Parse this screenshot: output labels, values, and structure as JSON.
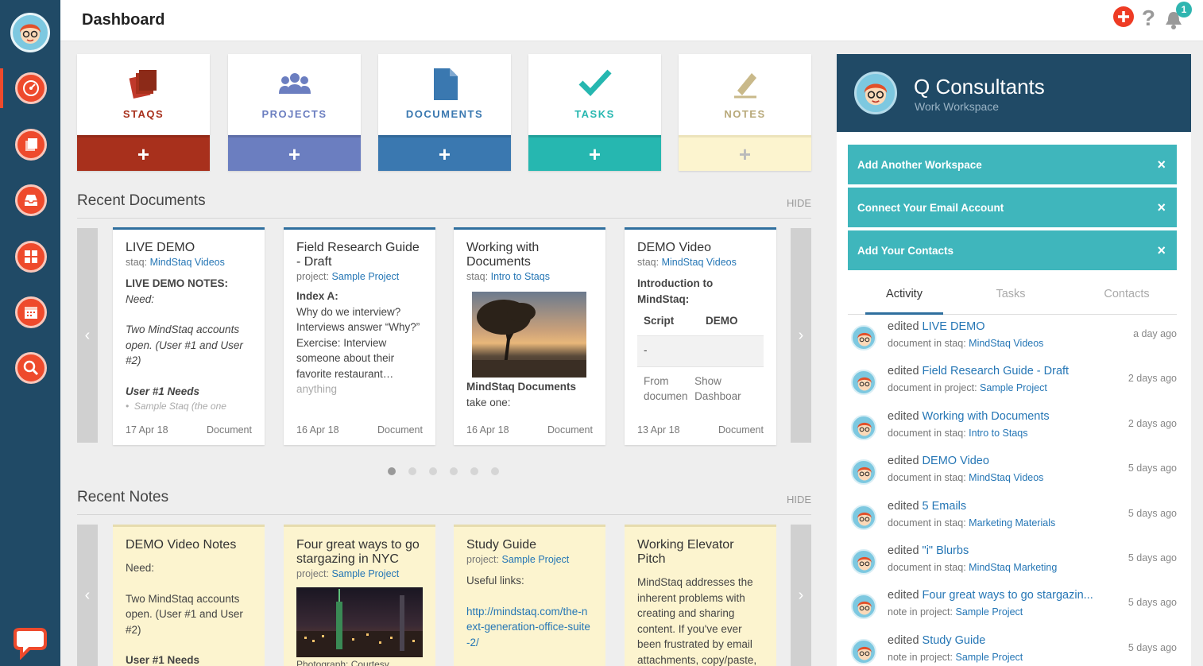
{
  "header": {
    "title": "Dashboard",
    "notification_count": "1"
  },
  "tiles": [
    {
      "label": "STAQS",
      "add": "+",
      "color": "#a8301c"
    },
    {
      "label": "PROJECTS",
      "add": "+",
      "color": "#6b7ec0"
    },
    {
      "label": "DOCUMENTS",
      "add": "+",
      "color": "#3a78b0"
    },
    {
      "label": "TASKS",
      "add": "+",
      "color": "#26b7b0"
    },
    {
      "label": "NOTES",
      "add": "+",
      "color": "#fcf4cf"
    }
  ],
  "recent_documents": {
    "title": "Recent Documents",
    "hide": "HIDE",
    "cards": [
      {
        "title": "LIVE DEMO",
        "sub_prefix": "staq:",
        "sub_link": "MindStaq Videos",
        "body1": "LIVE DEMO NOTES:",
        "body2": "Need:",
        "body3": "Two MindStaq accounts open. (User #1 and User #2)",
        "body4": "User #1 Needs",
        "body5": "Sample Staq (the one",
        "date": "17 Apr 18",
        "kind": "Document"
      },
      {
        "title": "Field Research Guide - Draft",
        "sub_prefix": "project:",
        "sub_link": "Sample Project",
        "body1": "Index A:",
        "body2": "Why do we interview? Interviews answer “Why?”",
        "body3": "Exercise: Interview someone about their favorite restaurant…",
        "body4": "anything",
        "date": "16 Apr 18",
        "kind": "Document"
      },
      {
        "title": "Working with Documents",
        "sub_prefix": "staq:",
        "sub_link": "Intro to Staqs",
        "body1": "MindStaq Documents",
        "body2": "take one:",
        "date": "16 Apr 18",
        "kind": "Document"
      },
      {
        "title": "DEMO Video",
        "sub_prefix": "staq:",
        "sub_link": "MindStaq Videos",
        "body1": "Introduction to MindStaq:",
        "col1": "Script",
        "col2": "DEMO",
        "cell": "-",
        "r1": "From documen",
        "r2": "Show Dashboar",
        "date": "13 Apr 18",
        "kind": "Document"
      }
    ]
  },
  "recent_notes": {
    "title": "Recent Notes",
    "hide": "HIDE",
    "cards": [
      {
        "title": "DEMO Video Notes",
        "body1": "Need:",
        "body2": "Two MindStaq accounts open. (User #1 and User #2)",
        "body3": "User #1 Needs"
      },
      {
        "title": "Four great ways to go stargazing in NYC",
        "sub_prefix": "project:",
        "sub_link": "Sample Project",
        "caption": "Photograph: Courtesy"
      },
      {
        "title": "Study Guide",
        "sub_prefix": "project:",
        "sub_link": "Sample Project",
        "body1": "Useful links:",
        "body2": "http://mindstaq.com/the-next-generation-office-suite-2/"
      },
      {
        "title": "Working Elevator Pitch",
        "body1": "MindStaq addresses the inherent problems with creating and sharing content. If you've ever been frustrated by email attachments, copy/paste,"
      }
    ]
  },
  "panel": {
    "workspace_name": "Q Consultants",
    "workspace_sub": "Work Workspace",
    "setup": [
      "Add Another Workspace",
      "Connect Your Email Account",
      "Add Your Contacts"
    ],
    "close": "×",
    "tabs": [
      "Activity",
      "Tasks",
      "Contacts"
    ],
    "activity": [
      {
        "verb": "edited",
        "item": "LIVE DEMO",
        "ctx": "document in staq:",
        "ctx_link": "MindStaq Videos",
        "time": "a day ago"
      },
      {
        "verb": "edited",
        "item": "Field Research Guide - Draft",
        "ctx": "document in project:",
        "ctx_link": "Sample Project",
        "time": "2 days ago"
      },
      {
        "verb": "edited",
        "item": "Working with Documents",
        "ctx": "document in staq:",
        "ctx_link": "Intro to Staqs",
        "time": "2 days ago"
      },
      {
        "verb": "edited",
        "item": "DEMO Video",
        "ctx": "document in staq:",
        "ctx_link": "MindStaq Videos",
        "time": "5 days ago"
      },
      {
        "verb": "edited",
        "item": "5 Emails",
        "ctx": "document in staq:",
        "ctx_link": "Marketing Materials",
        "time": "5 days ago"
      },
      {
        "verb": "edited",
        "item": "\"i\" Blurbs",
        "ctx": "document in staq:",
        "ctx_link": "MindStaq Marketing",
        "time": "5 days ago"
      },
      {
        "verb": "edited",
        "item": "Four great ways to go stargazin...",
        "ctx": "note in project:",
        "ctx_link": "Sample Project",
        "time": "5 days ago"
      },
      {
        "verb": "edited",
        "item": "Study Guide",
        "ctx": "note in project:",
        "ctx_link": "Sample Project",
        "time": "5 days ago"
      }
    ]
  },
  "icons": [
    "avatar",
    "dashboard-gauge-icon",
    "staqs-icon",
    "inbox-icon",
    "apps-grid-icon",
    "calendar-icon",
    "search-icon",
    "chat-icon",
    "add-icon",
    "help-icon",
    "bell-icon",
    "chevron-left-icon",
    "chevron-right-icon"
  ]
}
